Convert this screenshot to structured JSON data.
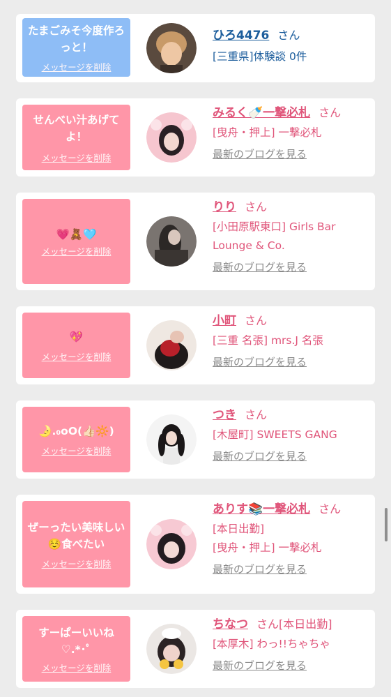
{
  "cards": [
    {
      "bubble_color": "blue",
      "message": "たまごみそ今度作ろっと！",
      "delete_label": "メッセージを削除",
      "name": "ひろ4476",
      "honorific": "さん",
      "details": [
        "[三重県]体験談 0件"
      ],
      "blog_label": ""
    },
    {
      "bubble_color": "pink",
      "message": "せんべい汁あげてよ！",
      "delete_label": "メッセージを削除",
      "name": "みるく🍼一撃必札",
      "honorific": "さん",
      "details": [
        "[曳舟・押上] 一撃必札"
      ],
      "blog_label": "最新のブログを見る"
    },
    {
      "bubble_color": "pink",
      "message": "💗🧸🩵",
      "delete_label": "メッセージを削除",
      "name": "りり",
      "honorific": "さん",
      "details": [
        "[小田原駅東口] Girls Bar Lounge & Co."
      ],
      "blog_label": "最新のブログを見る"
    },
    {
      "bubble_color": "pink",
      "message": "💖",
      "delete_label": "メッセージを削除",
      "name": "小町",
      "honorific": "さん",
      "details": [
        "[三重 名張] mrs.J 名張"
      ],
      "blog_label": "最新のブログを見る"
    },
    {
      "bubble_color": "pink",
      "message": "🌛.₀oO(👍🏻🔆)",
      "delete_label": "メッセージを削除",
      "name": "つき",
      "honorific": "さん",
      "details": [
        "[木屋町] SWEETS GANG"
      ],
      "blog_label": "最新のブログを見る"
    },
    {
      "bubble_color": "pink",
      "message": "ぜーったい美味しい☺️食べたい",
      "delete_label": "メッセージを削除",
      "name": "ありす📚一撃必札",
      "honorific": "さん",
      "details": [
        "[本日出勤]",
        "[曳舟・押上] 一撃必札"
      ],
      "blog_label": "最新のブログを見る"
    },
    {
      "bubble_color": "pink",
      "message": "すーぱーいいね♡.*･ﾟ",
      "delete_label": "メッセージを削除",
      "name": "ちなつ",
      "honorific": "さん[本日出勤]",
      "details": [
        "[本厚木] わっ!!ちゃちゃ"
      ],
      "blog_label": "最新のブログを見る"
    }
  ],
  "colors": {
    "pink_bubble": "#ff96a8",
    "blue_bubble": "#8ebdf6",
    "pink_text": "#e0557a",
    "blue_text": "#1c5d9c"
  }
}
